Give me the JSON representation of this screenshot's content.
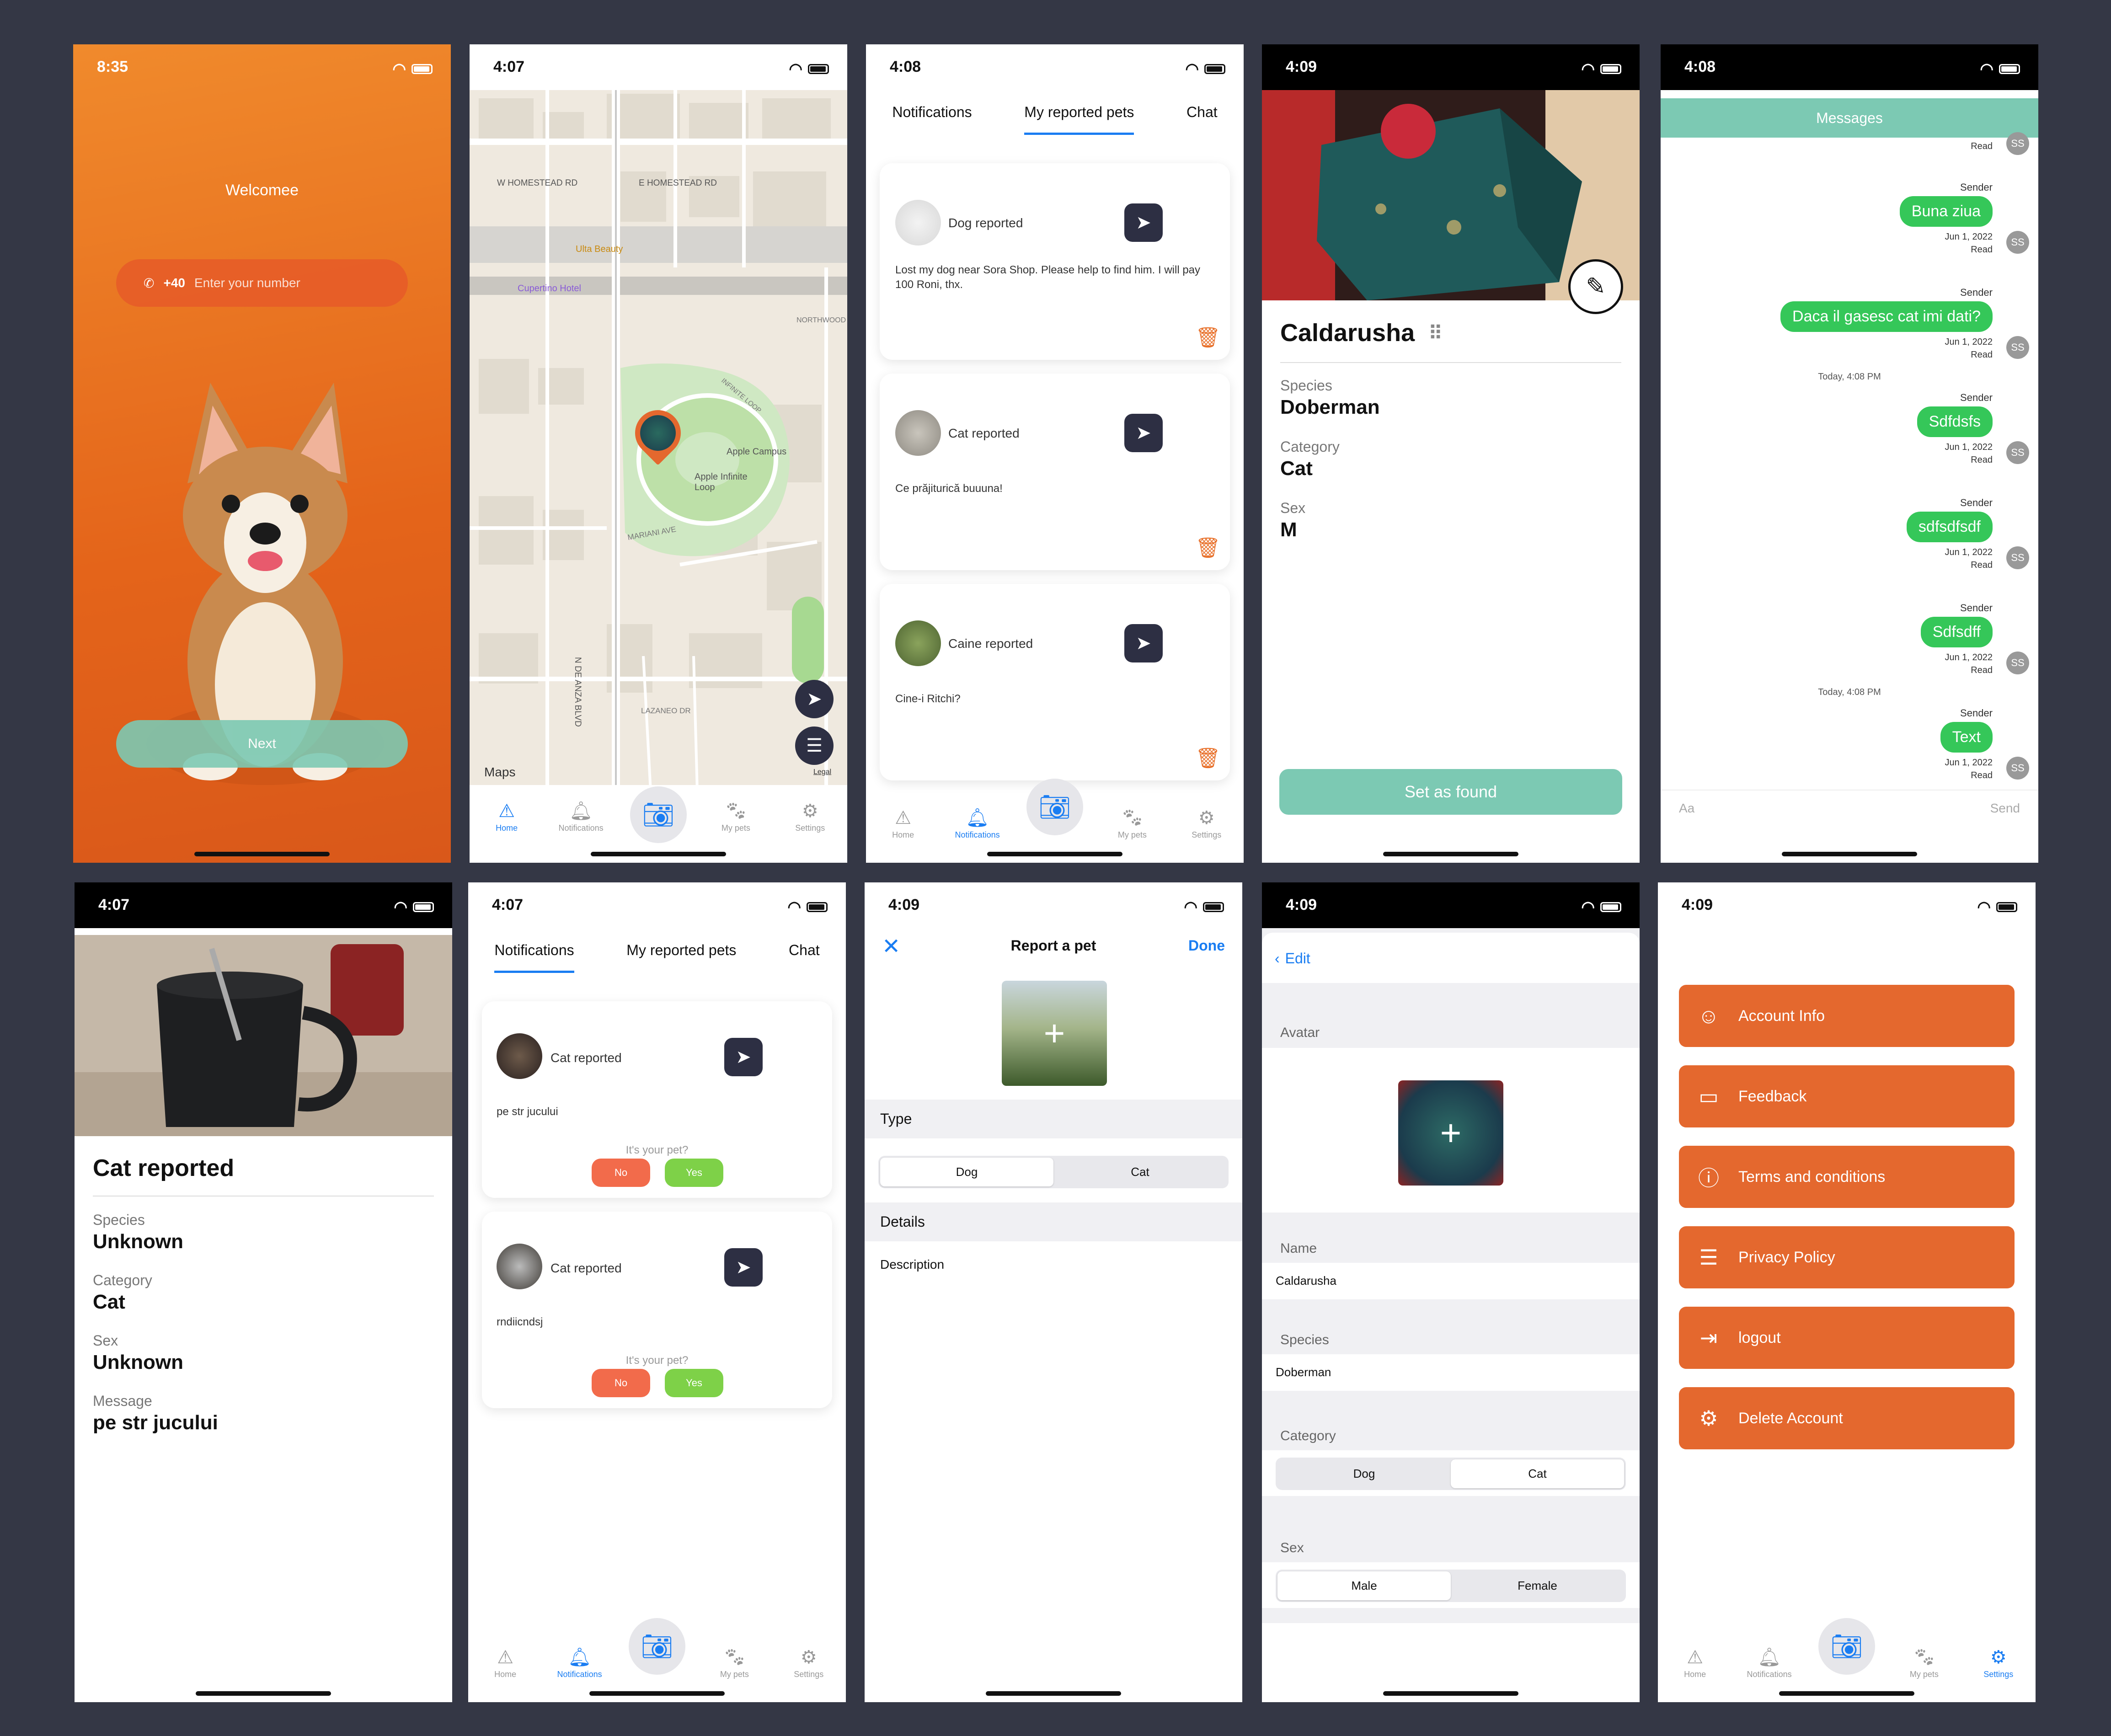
{
  "screens": {
    "welcome": {
      "time": "8:35",
      "title": "Welcomee",
      "country_code": "+40",
      "phone_placeholder": "Enter your number",
      "next_label": "Next"
    },
    "map": {
      "time": "4:07",
      "labels": [
        "W HOMESTEAD RD",
        "E HOMESTEAD RD",
        "Ulta Beauty",
        "Cupertino Hotel",
        "Apple Campus",
        "Apple Infinite Loop",
        "N DE ANZA BLVD",
        "MARIANI AVE",
        "LAZANEO DR",
        "NORTHWOOD",
        "INFINITE LOOP"
      ],
      "maps_label": "Maps",
      "legal_label": "Legal"
    },
    "my_reported": {
      "time": "4:08",
      "tabs": [
        "Notifications",
        "My reported pets",
        "Chat"
      ],
      "cards": [
        {
          "title": "Dog reported",
          "text": "Lost my dog near Sora Shop. Please help to find him. I will pay 100 Roni, thx."
        },
        {
          "title": "Cat reported",
          "text": "Ce prăjiturică buuuna!"
        },
        {
          "title": "Caine reported",
          "text": "Cine-i Ritchi?"
        }
      ]
    },
    "pet_detail": {
      "time": "4:09",
      "name": "Caldarusha",
      "fields": [
        {
          "label": "Species",
          "value": "Doberman"
        },
        {
          "label": "Category",
          "value": "Cat"
        },
        {
          "label": "Sex",
          "value": "M"
        }
      ],
      "button": "Set as found"
    },
    "chat": {
      "time": "4:08",
      "header": "Messages",
      "top_read": "Read",
      "messages": [
        {
          "sender": "Sender",
          "text": "Buna ziua",
          "date": "Jun 1, 2022",
          "status": "Read",
          "initials": "SS"
        },
        {
          "sender": "Sender",
          "text": "Daca il gasesc cat imi dati?",
          "date": "Jun 1, 2022",
          "status": "Read",
          "initials": "SS"
        },
        {
          "sender": "Sender",
          "text": "Sdfdsfs",
          "date": "Jun 1, 2022",
          "status": "Read",
          "initials": "SS"
        },
        {
          "sender": "Sender",
          "text": "sdfsdfsdf",
          "date": "Jun 1, 2022",
          "status": "Read",
          "initials": "SS"
        },
        {
          "sender": "Sender",
          "text": "Sdfsdff",
          "date": "Jun 1, 2022",
          "status": "Read",
          "initials": "SS"
        },
        {
          "sender": "Sender",
          "text": "Text",
          "date": "Jun 1, 2022",
          "status": "Read",
          "initials": "SS"
        }
      ],
      "day_separator": "Today, 4:08 PM",
      "input_placeholder": "Aa",
      "send_label": "Send"
    },
    "report_detail": {
      "time": "4:07",
      "title": "Cat reported",
      "fields": [
        {
          "label": "Species",
          "value": "Unknown"
        },
        {
          "label": "Category",
          "value": "Cat"
        },
        {
          "label": "Sex",
          "value": "Unknown"
        },
        {
          "label": "Message",
          "value": "pe str jucului"
        }
      ]
    },
    "notifications": {
      "time": "4:07",
      "tabs": [
        "Notifications",
        "My reported pets",
        "Chat"
      ],
      "cards": [
        {
          "title": "Cat reported",
          "text": "pe str jucului",
          "question": "It's your pet?",
          "no": "No",
          "yes": "Yes"
        },
        {
          "title": "Cat reported",
          "text": "rndiicndsj",
          "question": "It's your pet?",
          "no": "No",
          "yes": "Yes"
        }
      ]
    },
    "report_pet": {
      "time": "4:09",
      "title": "Report a pet",
      "done": "Done",
      "type_label": "Type",
      "type_options": [
        "Dog",
        "Cat"
      ],
      "details_label": "Details",
      "description_label": "Description"
    },
    "edit_pet": {
      "time": "4:09",
      "back_label": "Edit",
      "avatar_label": "Avatar",
      "name_label": "Name",
      "name_value": "Caldarusha",
      "species_label": "Species",
      "species_value": "Doberman",
      "category_label": "Category",
      "category_options": [
        "Dog",
        "Cat"
      ],
      "sex_label": "Sex",
      "sex_options": [
        "Male",
        "Female"
      ]
    },
    "settings": {
      "time": "4:09",
      "items": [
        {
          "label": "Account Info",
          "icon": "person-icon"
        },
        {
          "label": "Feedback",
          "icon": "chat-bubble-icon"
        },
        {
          "label": "Terms and conditions",
          "icon": "info-icon"
        },
        {
          "label": "Privacy Policy",
          "icon": "menu-icon"
        },
        {
          "label": "logout",
          "icon": "logout-icon"
        },
        {
          "label": "Delete Account",
          "icon": "person-gear-icon"
        }
      ]
    }
  },
  "tabbar": {
    "home": "Home",
    "notifications": "Notifications",
    "mypets": "My pets",
    "settings": "Settings"
  },
  "colors": {
    "accent": "#1a7df2",
    "orange": "#e4682e",
    "green": "#35c759",
    "teal": "#7cc9b3",
    "dark": "#2d2f43",
    "background": "#343745"
  }
}
